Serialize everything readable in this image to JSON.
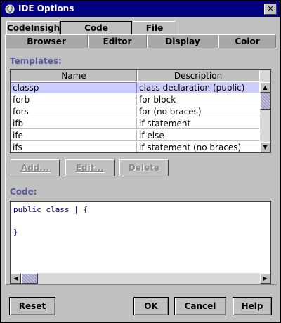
{
  "window": {
    "title": "IDE Options",
    "close_glyph": "✕"
  },
  "tabs_row1": [
    {
      "label": "CodeInsight",
      "selected": false
    },
    {
      "label": "Code Templates",
      "selected": true
    },
    {
      "label": "File Types",
      "selected": false
    }
  ],
  "tabs_row2": [
    {
      "label": "Browser"
    },
    {
      "label": "Editor"
    },
    {
      "label": "Display"
    },
    {
      "label": "Color"
    }
  ],
  "templates": {
    "label": "Templates:",
    "columns": [
      "Name",
      "Description"
    ],
    "rows": [
      {
        "name": "classp",
        "description": "class declaration (public)",
        "selected": true
      },
      {
        "name": "forb",
        "description": "for block"
      },
      {
        "name": "fors",
        "description": "for (no braces)"
      },
      {
        "name": "ifb",
        "description": "if statement"
      },
      {
        "name": "ife",
        "description": "if else"
      },
      {
        "name": "ifs",
        "description": "if statement (no braces)"
      }
    ],
    "buttons": {
      "add": "Add...",
      "edit": "Edit...",
      "delete": "Delete"
    }
  },
  "code": {
    "label": "Code:",
    "text": "public class | {\n\n}"
  },
  "dialog_buttons": {
    "reset": "Reset",
    "ok": "OK",
    "cancel": "Cancel",
    "help": "Help"
  },
  "icons": {
    "app": "app-icon",
    "close": "close-icon",
    "scroll_up": "scroll-up-icon",
    "scroll_down": "scroll-down-icon",
    "scroll_left": "scroll-left-icon",
    "scroll_right": "scroll-right-icon"
  },
  "colors": {
    "titlebar": "#000080",
    "selection": "#ccccff",
    "section_label": "#5a5aa0",
    "code_text": "#000080"
  }
}
